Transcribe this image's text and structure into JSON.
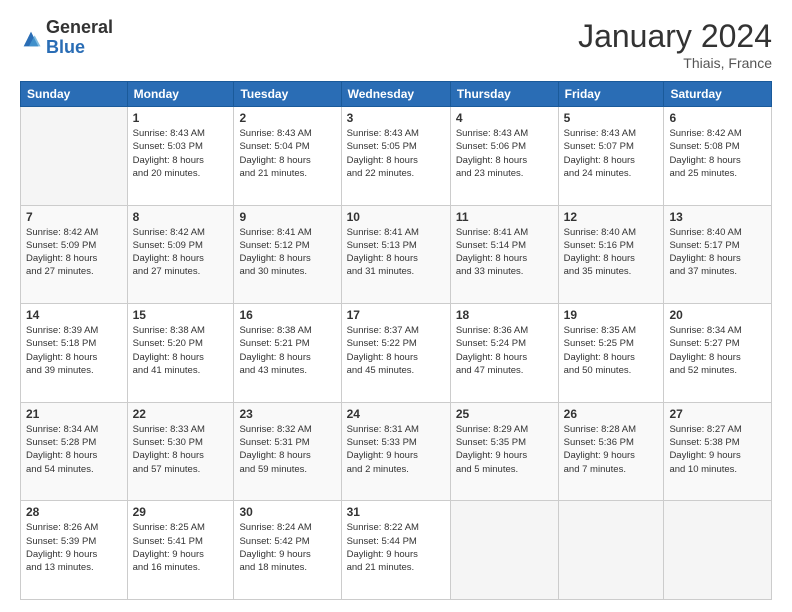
{
  "logo": {
    "general": "General",
    "blue": "Blue"
  },
  "header": {
    "title": "January 2024",
    "location": "Thiais, France"
  },
  "weekdays": [
    "Sunday",
    "Monday",
    "Tuesday",
    "Wednesday",
    "Thursday",
    "Friday",
    "Saturday"
  ],
  "weeks": [
    [
      {
        "day": "",
        "info": ""
      },
      {
        "day": "1",
        "info": "Sunrise: 8:43 AM\nSunset: 5:03 PM\nDaylight: 8 hours\nand 20 minutes."
      },
      {
        "day": "2",
        "info": "Sunrise: 8:43 AM\nSunset: 5:04 PM\nDaylight: 8 hours\nand 21 minutes."
      },
      {
        "day": "3",
        "info": "Sunrise: 8:43 AM\nSunset: 5:05 PM\nDaylight: 8 hours\nand 22 minutes."
      },
      {
        "day": "4",
        "info": "Sunrise: 8:43 AM\nSunset: 5:06 PM\nDaylight: 8 hours\nand 23 minutes."
      },
      {
        "day": "5",
        "info": "Sunrise: 8:43 AM\nSunset: 5:07 PM\nDaylight: 8 hours\nand 24 minutes."
      },
      {
        "day": "6",
        "info": "Sunrise: 8:42 AM\nSunset: 5:08 PM\nDaylight: 8 hours\nand 25 minutes."
      }
    ],
    [
      {
        "day": "7",
        "info": ""
      },
      {
        "day": "8",
        "info": "Sunrise: 8:42 AM\nSunset: 5:09 PM\nDaylight: 8 hours\nand 27 minutes."
      },
      {
        "day": "9",
        "info": "Sunrise: 8:41 AM\nSunset: 5:12 PM\nDaylight: 8 hours\nand 30 minutes."
      },
      {
        "day": "10",
        "info": "Sunrise: 8:41 AM\nSunset: 5:13 PM\nDaylight: 8 hours\nand 31 minutes."
      },
      {
        "day": "11",
        "info": "Sunrise: 8:41 AM\nSunset: 5:14 PM\nDaylight: 8 hours\nand 33 minutes."
      },
      {
        "day": "12",
        "info": "Sunrise: 8:40 AM\nSunset: 5:16 PM\nDaylight: 8 hours\nand 35 minutes."
      },
      {
        "day": "13",
        "info": "Sunrise: 8:40 AM\nSunset: 5:17 PM\nDaylight: 8 hours\nand 37 minutes."
      }
    ],
    [
      {
        "day": "14",
        "info": ""
      },
      {
        "day": "15",
        "info": "Sunrise: 8:38 AM\nSunset: 5:20 PM\nDaylight: 8 hours\nand 41 minutes."
      },
      {
        "day": "16",
        "info": "Sunrise: 8:38 AM\nSunset: 5:21 PM\nDaylight: 8 hours\nand 43 minutes."
      },
      {
        "day": "17",
        "info": "Sunrise: 8:37 AM\nSunset: 5:22 PM\nDaylight: 8 hours\nand 45 minutes."
      },
      {
        "day": "18",
        "info": "Sunrise: 8:36 AM\nSunset: 5:24 PM\nDaylight: 8 hours\nand 47 minutes."
      },
      {
        "day": "19",
        "info": "Sunrise: 8:35 AM\nSunset: 5:25 PM\nDaylight: 8 hours\nand 50 minutes."
      },
      {
        "day": "20",
        "info": "Sunrise: 8:34 AM\nSunset: 5:27 PM\nDaylight: 8 hours\nand 52 minutes."
      }
    ],
    [
      {
        "day": "21",
        "info": ""
      },
      {
        "day": "22",
        "info": "Sunrise: 8:33 AM\nSunset: 5:30 PM\nDaylight: 8 hours\nand 57 minutes."
      },
      {
        "day": "23",
        "info": "Sunrise: 8:32 AM\nSunset: 5:31 PM\nDaylight: 8 hours\nand 59 minutes."
      },
      {
        "day": "24",
        "info": "Sunrise: 8:31 AM\nSunset: 5:33 PM\nDaylight: 9 hours\nand 2 minutes."
      },
      {
        "day": "25",
        "info": "Sunrise: 8:29 AM\nSunset: 5:35 PM\nDaylight: 9 hours\nand 5 minutes."
      },
      {
        "day": "26",
        "info": "Sunrise: 8:28 AM\nSunset: 5:36 PM\nDaylight: 9 hours\nand 7 minutes."
      },
      {
        "day": "27",
        "info": "Sunrise: 8:27 AM\nSunset: 5:38 PM\nDaylight: 9 hours\nand 10 minutes."
      }
    ],
    [
      {
        "day": "28",
        "info": ""
      },
      {
        "day": "29",
        "info": "Sunrise: 8:25 AM\nSunset: 5:41 PM\nDaylight: 9 hours\nand 16 minutes."
      },
      {
        "day": "30",
        "info": "Sunrise: 8:24 AM\nSunset: 5:42 PM\nDaylight: 9 hours\nand 18 minutes."
      },
      {
        "day": "31",
        "info": "Sunrise: 8:22 AM\nSunset: 5:44 PM\nDaylight: 9 hours\nand 21 minutes."
      },
      {
        "day": "",
        "info": ""
      },
      {
        "day": "",
        "info": ""
      },
      {
        "day": "",
        "info": ""
      }
    ]
  ],
  "week_sunday_info": [
    "Sunrise: 8:42 AM\nSunset: 5:09 PM\nDaylight: 8 hours\nand 27 minutes.",
    "Sunrise: 8:39 AM\nSunset: 5:18 PM\nDaylight: 8 hours\nand 39 minutes.",
    "Sunrise: 8:34 AM\nSunset: 5:28 PM\nDaylight: 8 hours\nand 54 minutes.",
    "Sunrise: 8:26 AM\nSunset: 5:39 PM\nDaylight: 9 hours\nand 13 minutes."
  ]
}
